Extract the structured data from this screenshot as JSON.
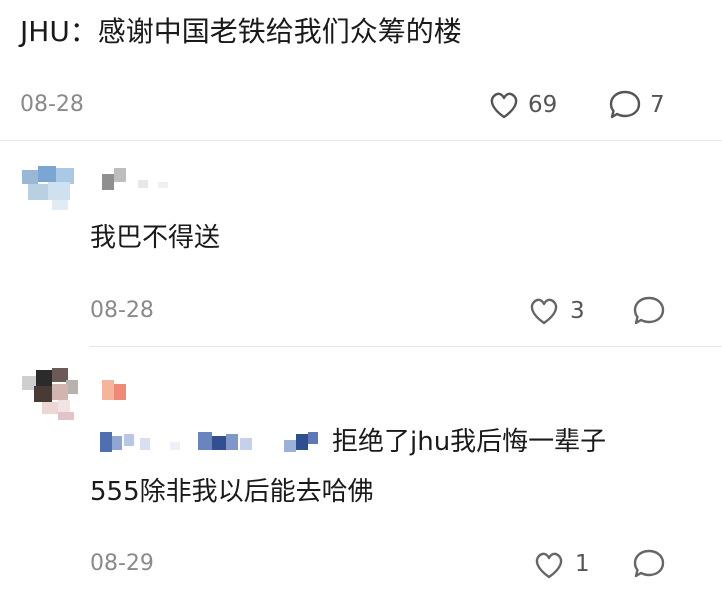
{
  "post": {
    "text": "JHU：感谢中国老铁给我们众筹的楼",
    "date": "08-28",
    "likes": "69",
    "comments": "7"
  },
  "comments": [
    {
      "text": "我巴不得送",
      "date": "08-28",
      "likes": "3"
    },
    {
      "text_line1": "拒绝了jhu我后悔一辈子",
      "text_line2": "555除非我以后能去哈佛",
      "date": "08-29",
      "likes": "1"
    }
  ],
  "icons": {
    "like": "heart-outline-icon",
    "reply": "speech-bubble-icon"
  },
  "colors": {
    "text": "#1a1a1a",
    "meta": "#8a8a8a",
    "icon": "#666666",
    "divider": "#e6e6e6"
  }
}
